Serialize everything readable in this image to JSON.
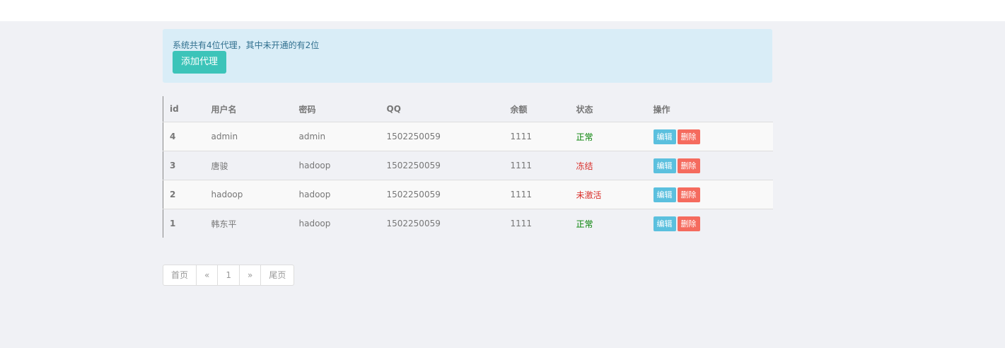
{
  "alert": {
    "text": "系统共有4位代理，其中未开通的有2位",
    "add_button_label": "添加代理"
  },
  "table": {
    "headers": [
      "id",
      "用户名",
      "密码",
      "QQ",
      "余额",
      "状态",
      "操作"
    ],
    "rows": [
      {
        "id": "4",
        "username": "admin",
        "password": "admin",
        "qq": "1502250059",
        "balance": "1111",
        "status": "正常",
        "status_color": "#008000"
      },
      {
        "id": "3",
        "username": "唐骏",
        "password": "hadoop",
        "qq": "1502250059",
        "balance": "1111",
        "status": "冻结",
        "status_color": "#d9302b"
      },
      {
        "id": "2",
        "username": "hadoop",
        "password": "hadoop",
        "qq": "1502250059",
        "balance": "1111",
        "status": "未激活",
        "status_color": "#d9302b"
      },
      {
        "id": "1",
        "username": "韩东平",
        "password": "hadoop",
        "qq": "1502250059",
        "balance": "1111",
        "status": "正常",
        "status_color": "#008000"
      }
    ],
    "edit_label": "编辑",
    "delete_label": "删除"
  },
  "pager": {
    "first": "首页",
    "prev": "«",
    "current": "1",
    "next": "»",
    "last": "尾页"
  },
  "colors": {
    "accent": "#3cc4b9",
    "alert_bg": "#d9edf7",
    "edit_button": "#5bc0de",
    "delete_button": "#f56b5e",
    "page_bg": "#f0f1f5"
  }
}
